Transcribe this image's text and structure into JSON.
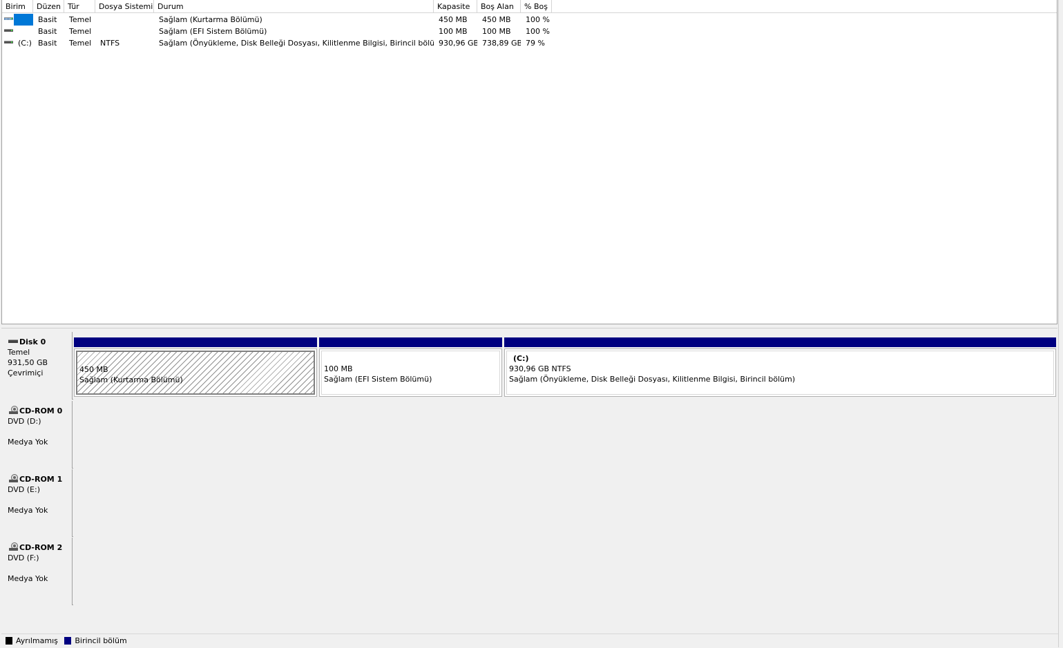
{
  "volume_table": {
    "columns": [
      "Birim",
      "Düzen",
      "Tür",
      "Dosya Sistemi",
      "Durum",
      "Kapasite",
      "Boş Alan",
      "% Boş"
    ],
    "rows": [
      {
        "birim": "",
        "duzen": "Basit",
        "tur": "Temel",
        "dosya_sistemi": "",
        "durum": "Sağlam (Kurtarma Bölümü)",
        "kapasite": "450 MB",
        "bos_alan": "450 MB",
        "yuzde_bos": "100 %"
      },
      {
        "birim": "",
        "duzen": "Basit",
        "tur": "Temel",
        "dosya_sistemi": "",
        "durum": "Sağlam (EFI Sistem Bölümü)",
        "kapasite": "100 MB",
        "bos_alan": "100 MB",
        "yuzde_bos": "100 %"
      },
      {
        "birim": "(C:)",
        "duzen": "Basit",
        "tur": "Temel",
        "dosya_sistemi": "NTFS",
        "durum": "Sağlam (Önyükleme, Disk Belleği Dosyası, Kilitlenme Bilgisi, Birincil bölüm)",
        "kapasite": "930,96 GB",
        "bos_alan": "738,89 GB",
        "yuzde_bos": "79 %"
      }
    ]
  },
  "disks": [
    {
      "name": "Disk 0",
      "icon": "hard-disk-icon",
      "type": "Temel",
      "size": "931,50 GB",
      "status": "Çevrimiçi",
      "partitions": [
        {
          "label": "",
          "size": "450 MB",
          "status": "Sağlam (Kurtarma Bölümü)"
        },
        {
          "label": "",
          "size": "100 MB",
          "status": "Sağlam (EFI Sistem Bölümü)"
        },
        {
          "label": "(C:)",
          "size": "930,96 GB NTFS",
          "status": "Sağlam (Önyükleme, Disk Belleği Dosyası, Kilitlenme Bilgisi, Birincil bölüm)"
        }
      ]
    },
    {
      "name": "CD-ROM 0",
      "icon": "cd-rom-icon",
      "type": "DVD (D:)",
      "status": "Medya Yok"
    },
    {
      "name": "CD-ROM 1",
      "icon": "cd-rom-icon",
      "type": "DVD (E:)",
      "status": "Medya Yok"
    },
    {
      "name": "CD-ROM 2",
      "icon": "cd-rom-icon",
      "type": "DVD (F:)",
      "status": "Medya Yok"
    }
  ],
  "legend": [
    {
      "label": "Ayrılmamış",
      "color": "#000000"
    },
    {
      "label": "Birincil bölüm",
      "color": "#000080"
    }
  ],
  "colors": {
    "primary_partition": "#000080",
    "selection": "#0078d7"
  }
}
